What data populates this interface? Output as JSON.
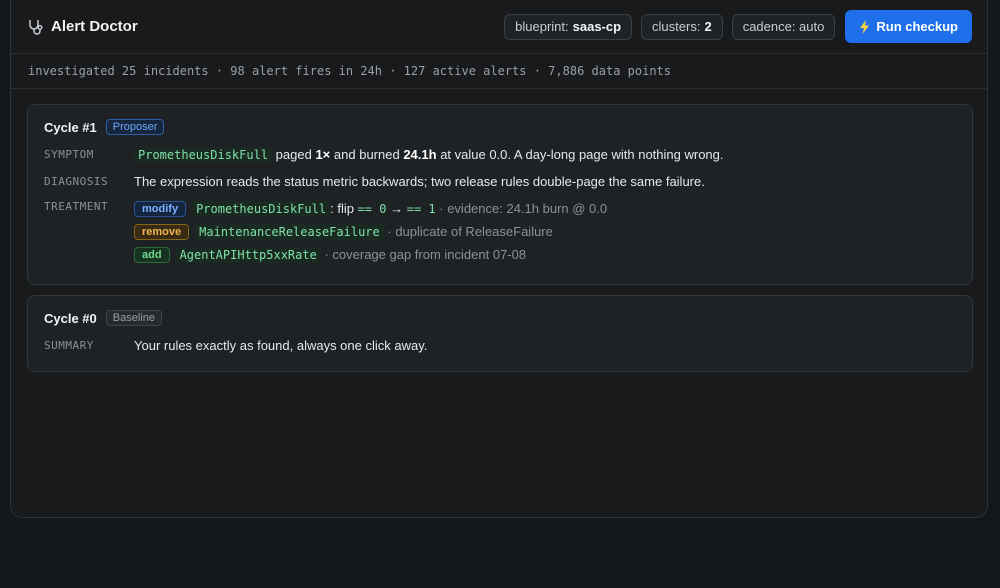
{
  "header": {
    "title": "Alert Doctor",
    "blueprint_label": "blueprint:",
    "blueprint_value": "saas-cp",
    "clusters_label": "clusters:",
    "clusters_value": "2",
    "cadence_label": "cadence: auto",
    "run_button": "Run checkup",
    "accent": "#1f6feb"
  },
  "stats": "investigated 25 incidents · 98 alert fires in 24h · 127 active alerts · 7,886 data points",
  "cycles": [
    {
      "title": "Cycle #1",
      "tag": "Proposer",
      "symptom": {
        "label": "SYMPTOM",
        "rule": "PrometheusDiskFull",
        "t1": "paged",
        "count": "1×",
        "t2": "and burned",
        "duration": "24.1h",
        "t3": "at value 0.0. A day-long page with nothing wrong."
      },
      "diagnosis": {
        "label": "DIAGNOSIS",
        "text": "The expression reads the status metric backwards; two release rules double-page the same failure."
      },
      "treatment": {
        "label": "TREATMENT",
        "items": [
          {
            "op": "modify",
            "rule": "PrometheusDiskFull",
            "text": ": flip",
            "from": "== 0",
            "arrow": "→",
            "to": "== 1",
            "note": "· evidence: 24.1h burn @ 0.0"
          },
          {
            "op": "remove",
            "rule": "MaintenanceReleaseFailure",
            "note": "· duplicate of ReleaseFailure"
          },
          {
            "op": "add",
            "rule": "AgentAPIHttp5xxRate",
            "note": "· coverage gap from incident 07-08"
          }
        ]
      }
    },
    {
      "title": "Cycle #0",
      "tag": "Baseline",
      "summary": {
        "label": "SUMMARY",
        "text": "Your rules exactly as found, always one click away."
      }
    }
  ]
}
